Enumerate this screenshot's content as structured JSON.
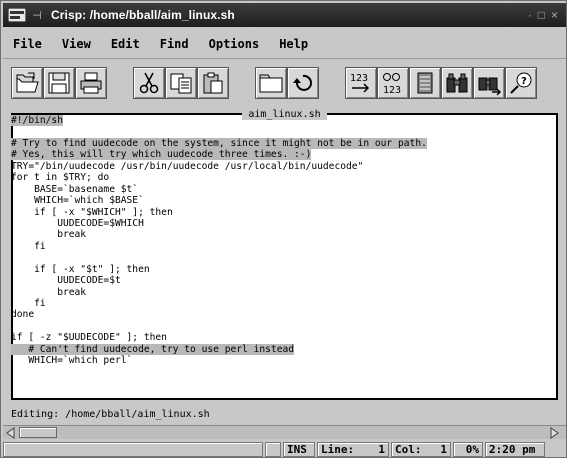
{
  "window": {
    "title": "Crisp: /home/bball/aim_linux.sh",
    "pin_glyph": "⊣",
    "controls": [
      "·",
      "□",
      "×"
    ]
  },
  "menu": [
    "File",
    "View",
    "Edit",
    "Find",
    "Options",
    "Help"
  ],
  "toolbar": {
    "groups": [
      [
        "open-file-icon",
        "save-icon",
        "print-icon"
      ],
      [
        "cut-icon",
        "copy-icon",
        "paste-icon"
      ],
      [
        "new-buffer-icon",
        "undo-icon"
      ],
      [
        "goto-line-icon",
        "replace-icon",
        "bookmark-icon",
        "find-icon",
        "find-next-icon",
        "help-icon"
      ]
    ],
    "goto_line_label": "123",
    "replace_label": "123"
  },
  "editor": {
    "frame_title": "aim_linux.sh",
    "lines": [
      {
        "text": "#!/bin/sh",
        "hl": true
      },
      {
        "text": "",
        "hl": false
      },
      {
        "text": "# Try to find uudecode on the system, since it might not be in our path.",
        "hl": true
      },
      {
        "text": "# Yes, this will try which uudecode three times. :-)",
        "hl": true
      },
      {
        "text": "TRY=\"/bin/uudecode /usr/bin/uudecode /usr/local/bin/uudecode\"",
        "hl": false
      },
      {
        "text": "for t in $TRY; do",
        "hl": false
      },
      {
        "text": "    BASE=`basename $t`",
        "hl": false
      },
      {
        "text": "    WHICH=`which $BASE`",
        "hl": false
      },
      {
        "text": "    if [ -x \"$WHICH\" ]; then",
        "hl": false
      },
      {
        "text": "        UUDECODE=$WHICH",
        "hl": false
      },
      {
        "text": "        break",
        "hl": false
      },
      {
        "text": "    fi",
        "hl": false
      },
      {
        "text": "",
        "hl": false
      },
      {
        "text": "    if [ -x \"$t\" ]; then",
        "hl": false
      },
      {
        "text": "        UUDECODE=$t",
        "hl": false
      },
      {
        "text": "        break",
        "hl": false
      },
      {
        "text": "    fi",
        "hl": false
      },
      {
        "text": "done",
        "hl": false
      },
      {
        "text": "",
        "hl": false
      },
      {
        "text": "if [ -z \"$UUDECODE\" ]; then",
        "hl": false
      },
      {
        "text": "   # Can't find uudecode, try to use perl instead",
        "hl": true
      },
      {
        "text": "   WHICH=`which perl`",
        "hl": false
      }
    ]
  },
  "status": {
    "editing": "Editing: /home/bball/aim_linux.sh"
  },
  "bottombar": {
    "mode": "INS",
    "line_label": "Line:",
    "line_value": "1",
    "col_label": "Col:",
    "col_value": "1",
    "percent": "0%",
    "time": "2:20 pm"
  }
}
